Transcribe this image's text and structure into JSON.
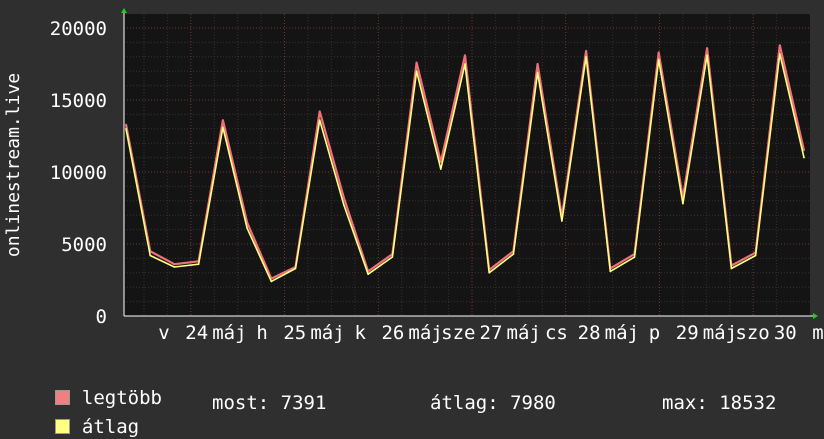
{
  "chart_data": {
    "type": "area",
    "title": "",
    "ylabel": "onlinestream.live",
    "ylim": [
      0,
      20000
    ],
    "y_ticks": [
      "0",
      "5000",
      "10000",
      "15000",
      "20000"
    ],
    "x_tick_labels": [
      "v",
      "24",
      "máj",
      "h",
      "25",
      "máj",
      "k",
      "26",
      "máj",
      "sze",
      "27",
      "máj",
      "cs",
      "28",
      "máj",
      "p",
      "29",
      "máj",
      "szo",
      "30",
      "m"
    ],
    "x": [
      "05-23 12:00",
      "05-23 18:00",
      "05-24 00:00",
      "05-24 06:00",
      "05-24 12:00",
      "05-24 18:00",
      "05-25 00:00",
      "05-25 06:00",
      "05-25 12:00",
      "05-25 18:00",
      "05-26 00:00",
      "05-26 06:00",
      "05-26 12:00",
      "05-26 18:00",
      "05-27 00:00",
      "05-27 06:00",
      "05-27 12:00",
      "05-27 18:00",
      "05-28 00:00",
      "05-28 06:00",
      "05-28 12:00",
      "05-28 18:00",
      "05-29 00:00",
      "05-29 06:00",
      "05-29 12:00",
      "05-29 18:00",
      "05-30 00:00",
      "05-30 06:00",
      "05-30 12:00"
    ],
    "series": [
      {
        "name": "legtöbb",
        "color": "#f0707a",
        "values": [
          13300,
          4500,
          3600,
          3800,
          13600,
          6500,
          2600,
          3400,
          14200,
          8200,
          3100,
          4300,
          17600,
          10700,
          18100,
          3200,
          4500,
          17500,
          6900,
          18400,
          3300,
          4300,
          18300,
          8200,
          18600,
          3500,
          4400,
          18800,
          11500
        ]
      },
      {
        "name": "átlag",
        "color": "#ffff80",
        "values": [
          13000,
          4200,
          3400,
          3600,
          13100,
          6100,
          2400,
          3300,
          13600,
          7700,
          2900,
          4100,
          17000,
          10200,
          17500,
          3000,
          4300,
          16900,
          6600,
          18000,
          3100,
          4100,
          17800,
          7800,
          18100,
          3300,
          4200,
          18200,
          11000
        ]
      }
    ],
    "grid": true
  },
  "legend": [
    {
      "label": "legtöbb",
      "color": "#f08080"
    },
    {
      "label": "átlag",
      "color": "#ffff80"
    }
  ],
  "stats": {
    "most": "most: 7391",
    "atlag": "átlag: 7980",
    "max": "max: 18532"
  }
}
